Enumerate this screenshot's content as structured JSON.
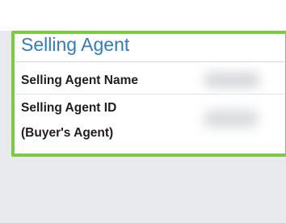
{
  "section": {
    "title": "Selling Agent",
    "fields": [
      {
        "label": "Selling Agent Name",
        "value": ""
      },
      {
        "label_line1": "Selling Agent ID",
        "label_line2": "(Buyer's Agent)",
        "value": ""
      }
    ]
  },
  "colors": {
    "title": "#2f7cc0",
    "highlight": "#7acb42",
    "background": "#e9eaee"
  }
}
